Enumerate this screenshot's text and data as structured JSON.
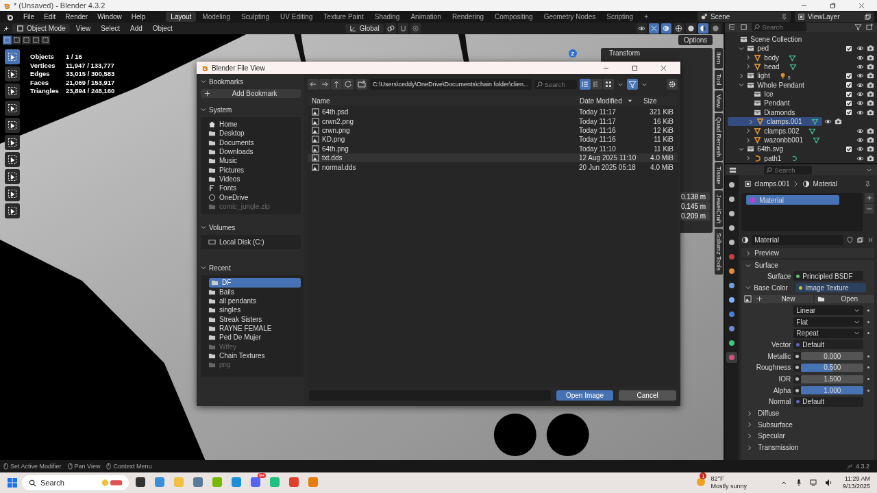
{
  "window": {
    "title": "* (Unsaved) - Blender 4.3.2"
  },
  "menu": [
    "File",
    "Edit",
    "Render",
    "Window",
    "Help"
  ],
  "workspaces": [
    {
      "label": "Layout",
      "selected": true
    },
    {
      "label": "Modeling",
      "selected": false
    },
    {
      "label": "Sculpting",
      "selected": false
    },
    {
      "label": "UV Editing",
      "selected": false
    },
    {
      "label": "Texture Paint",
      "selected": false
    },
    {
      "label": "Shading",
      "selected": false
    },
    {
      "label": "Animation",
      "selected": false
    },
    {
      "label": "Rendering",
      "selected": false
    },
    {
      "label": "Compositing",
      "selected": false
    },
    {
      "label": "Geometry Nodes",
      "selected": false
    },
    {
      "label": "Scripting",
      "selected": false
    }
  ],
  "add_workspace": "+",
  "scene": "Scene",
  "view_layer": "ViewLayer",
  "viewport": {
    "mode": "Object Mode",
    "menus": [
      "View",
      "Select",
      "Add",
      "Object"
    ],
    "orientation": "Global",
    "options": "Options",
    "tools": [
      {
        "selected": true
      },
      {
        "selected": false
      },
      {
        "selected": false
      },
      {
        "selected": false
      },
      {
        "selected": false
      },
      {
        "selected": false
      },
      {
        "selected": false
      },
      {
        "selected": false
      },
      {
        "selected": false
      },
      {
        "selected": false
      }
    ],
    "stats": [
      {
        "label": "Objects",
        "value": "1 / 16"
      },
      {
        "label": "Vertices",
        "value": "11,947 / 133,777"
      },
      {
        "label": "Edges",
        "value": "33,015 / 300,583"
      },
      {
        "label": "Faces",
        "value": "21,069 / 153,917"
      },
      {
        "label": "Triangles",
        "value": "23,894 / 248,160"
      }
    ],
    "axis_label": "Z",
    "transform": {
      "title": "Transform",
      "values": [
        "0.138 m",
        "0.145 m",
        "0.209 m"
      ]
    },
    "tabs": [
      "Item",
      "Tool",
      "View",
      "Quad Remesh",
      "Tissue",
      "JewelCraft",
      "Sollumz Tools"
    ]
  },
  "dialog": {
    "title": "Blender File View",
    "bookmarks": {
      "title": "Bookmarks",
      "add": "Add Bookmark"
    },
    "system": {
      "title": "System",
      "items": [
        {
          "label": "Home",
          "disabled": false
        },
        {
          "label": "Desktop",
          "disabled": false
        },
        {
          "label": "Documents",
          "disabled": false
        },
        {
          "label": "Downloads",
          "disabled": false
        },
        {
          "label": "Music",
          "disabled": false
        },
        {
          "label": "Pictures",
          "disabled": false
        },
        {
          "label": "Videos",
          "disabled": false
        },
        {
          "label": "Fonts",
          "disabled": false
        },
        {
          "label": "OneDrive",
          "disabled": false
        },
        {
          "label": "comic_jungle.zip",
          "disabled": true
        }
      ]
    },
    "volumes": {
      "title": "Volumes",
      "items": [
        "Local Disk (C:)"
      ]
    },
    "recent": {
      "title": "Recent",
      "items": [
        {
          "label": "DF",
          "selected": true,
          "disabled": false
        },
        {
          "label": "Bails",
          "selected": false,
          "disabled": false
        },
        {
          "label": "all pendants",
          "selected": false,
          "disabled": false
        },
        {
          "label": "singles",
          "selected": false,
          "disabled": false
        },
        {
          "label": "Streak Sisters",
          "selected": false,
          "disabled": false
        },
        {
          "label": "RAYNE FEMALE",
          "selected": false,
          "disabled": false
        },
        {
          "label": "Ped De Mujer",
          "selected": false,
          "disabled": false
        },
        {
          "label": "Wifey",
          "selected": false,
          "disabled": true
        },
        {
          "label": "Chain Textures",
          "selected": false,
          "disabled": false
        },
        {
          "label": "png",
          "selected": false,
          "disabled": true
        }
      ]
    },
    "path": "C:\\Users\\ceddy\\OneDrive\\Documents\\chain folder\\clien...",
    "search_placeholder": "Search",
    "columns": [
      "Name",
      "Date Modified",
      "Size"
    ],
    "files": [
      {
        "name": "64th.psd",
        "date": "Today 11:17",
        "size": "321 KiB",
        "hovered": false
      },
      {
        "name": "crwn2.png",
        "date": "Today 11:17",
        "size": "16 KiB",
        "hovered": false
      },
      {
        "name": "crwn.png",
        "date": "Today 11:16",
        "size": "12 KiB",
        "hovered": false
      },
      {
        "name": "KD.png",
        "date": "Today 11:16",
        "size": "11 KiB",
        "hovered": false
      },
      {
        "name": "64th.png",
        "date": "Today 11:10",
        "size": "11 KiB",
        "hovered": false
      },
      {
        "name": "txt.dds",
        "date": "12 Aug 2025 11:10",
        "size": "4.0 MiB",
        "hovered": true
      },
      {
        "name": "normal.dds",
        "date": "20 Jun 2025 05:18",
        "size": "4.0 MiB",
        "hovered": false
      }
    ],
    "open": "Open Image",
    "cancel": "Cancel"
  },
  "outliner": {
    "search_placeholder": "Search",
    "items": [
      {
        "name": "Scene Collection",
        "kind": "scene",
        "selected": false,
        "children": [
          {
            "name": "ped",
            "kind": "collection",
            "expanded": true,
            "checked": true,
            "selected": false,
            "children": [
              {
                "name": "body",
                "kind": "mesh",
                "expanded": false,
                "selected": false
              },
              {
                "name": "head",
                "kind": "mesh",
                "expanded": false,
                "selected": false
              }
            ]
          },
          {
            "name": "light",
            "kind": "collection",
            "expanded": false,
            "checked": true,
            "selected": false,
            "badge": "5"
          },
          {
            "name": "Whole Pendant",
            "kind": "collection",
            "expanded": true,
            "checked": true,
            "selected": false,
            "children": [
              {
                "name": "Ice",
                "kind": "collection",
                "checked": true,
                "selected": false
              },
              {
                "name": "Pendant",
                "kind": "collection",
                "checked": true,
                "selected": false
              },
              {
                "name": "Diamonds",
                "kind": "collection",
                "checked": true,
                "selected": false
              },
              {
                "name": "clamps.001",
                "kind": "mesh",
                "expanded": false,
                "selected": true
              },
              {
                "name": "clamps.002",
                "kind": "mesh",
                "expanded": false,
                "selected": false
              },
              {
                "name": "wazonbb001",
                "kind": "mesh",
                "expanded": false,
                "selected": false
              }
            ]
          },
          {
            "name": "64th.svg",
            "kind": "collection",
            "expanded": true,
            "checked": true,
            "selected": false,
            "children": [
              {
                "name": "path1",
                "kind": "curve",
                "expanded": false,
                "selected": false
              }
            ]
          }
        ]
      }
    ]
  },
  "properties": {
    "search_placeholder": "Search",
    "object": "clamps.001",
    "data": "Material",
    "slots": [
      {
        "name": "Material",
        "selected": true
      }
    ],
    "material": "Material",
    "preview": {
      "title": "Preview",
      "expanded": false
    },
    "surface": {
      "title": "Surface",
      "expanded": true,
      "rows": [
        {
          "kind": "socket",
          "label": "Surface",
          "value": "Principled BSDF",
          "color": "#63c763"
        },
        {
          "kind": "link",
          "label": "Base Color",
          "value": "Image Texture",
          "color": "#c7c729",
          "expanded": true
        },
        {
          "kind": "image",
          "new": "New",
          "open": "Open"
        },
        {
          "kind": "enum",
          "value": "Linear"
        },
        {
          "kind": "enum",
          "value": "Flat"
        },
        {
          "kind": "enum",
          "value": "Repeat"
        },
        {
          "kind": "socket",
          "label": "Vector",
          "value": "Default",
          "color": "#6363c7"
        },
        {
          "kind": "slider",
          "label": "Metallic",
          "value": "0.000",
          "level": 0
        },
        {
          "kind": "slider",
          "label": "Roughness",
          "value": "0.500",
          "level": 0.5
        },
        {
          "kind": "slider",
          "label": "IOR",
          "value": "1.500",
          "level": 0
        },
        {
          "kind": "slider",
          "label": "Alpha",
          "value": "1.000",
          "level": 1
        },
        {
          "kind": "socket",
          "label": "Normal",
          "value": "Default",
          "color": "#6363c7"
        }
      ],
      "subpanels": [
        {
          "title": "Diffuse",
          "expanded": false
        },
        {
          "title": "Subsurface",
          "expanded": false
        },
        {
          "title": "Specular",
          "expanded": false
        },
        {
          "title": "Transmission",
          "expanded": false
        }
      ]
    }
  },
  "status_bar": {
    "hints": [
      "Set Active Modifier",
      "Pan View",
      "Context Menu"
    ],
    "version": "4.3.2"
  },
  "taskbar": {
    "search": "Search",
    "chat_badge": "9+",
    "weather": {
      "badge": "1",
      "temp": "82°F",
      "text": "Mostly sunny"
    },
    "clock": {
      "time": "11:29 AM",
      "date": "9/13/2025"
    }
  }
}
